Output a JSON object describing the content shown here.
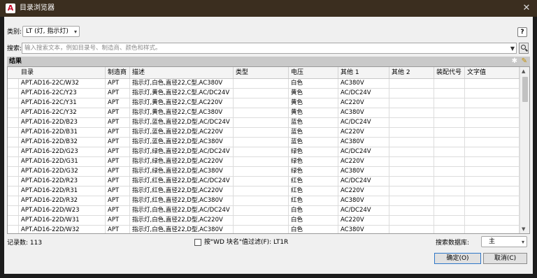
{
  "window": {
    "title": "目录浏览器",
    "app_icon": "A"
  },
  "category": {
    "label": "类别:",
    "value": "LT (灯, 指示灯)"
  },
  "search": {
    "label": "搜索:",
    "placeholder": "输入搜索文本，例如目录号、制造商、颜色和样式。"
  },
  "results": {
    "label": "结果"
  },
  "table": {
    "columns": [
      "目录",
      "制造商",
      "描述",
      "类型",
      "电压",
      "其他 1",
      "其他 2",
      "装配代号",
      "文字值"
    ],
    "rows": [
      [
        "APT.AD16-22C/W32",
        "APT",
        "指示灯,白色,直径22,C型,AC380V",
        "",
        "白色",
        "AC380V",
        "",
        "",
        ""
      ],
      [
        "APT.AD16-22C/Y23",
        "APT",
        "指示灯,黄色,直径22,C型,AC/DC24V",
        "",
        "黄色",
        "AC/DC24V",
        "",
        "",
        ""
      ],
      [
        "APT.AD16-22C/Y31",
        "APT",
        "指示灯,黄色,直径22,C型,AC220V",
        "",
        "黄色",
        "AC220V",
        "",
        "",
        ""
      ],
      [
        "APT.AD16-22C/Y32",
        "APT",
        "指示灯,黄色,直径22,C型,AC380V",
        "",
        "黄色",
        "AC380V",
        "",
        "",
        ""
      ],
      [
        "APT.AD16-22D/B23",
        "APT",
        "指示灯,蓝色,直径22,D型,AC/DC24V",
        "",
        "蓝色",
        "AC/DC24V",
        "",
        "",
        ""
      ],
      [
        "APT.AD16-22D/B31",
        "APT",
        "指示灯,蓝色,直径22,D型,AC220V",
        "",
        "蓝色",
        "AC220V",
        "",
        "",
        ""
      ],
      [
        "APT.AD16-22D/B32",
        "APT",
        "指示灯,蓝色,直径22,D型,AC380V",
        "",
        "蓝色",
        "AC380V",
        "",
        "",
        ""
      ],
      [
        "APT.AD16-22D/G23",
        "APT",
        "指示灯,绿色,直径22,D型,AC/DC24V",
        "",
        "绿色",
        "AC/DC24V",
        "",
        "",
        ""
      ],
      [
        "APT.AD16-22D/G31",
        "APT",
        "指示灯,绿色,直径22,D型,AC220V",
        "",
        "绿色",
        "AC220V",
        "",
        "",
        ""
      ],
      [
        "APT.AD16-22D/G32",
        "APT",
        "指示灯,绿色,直径22,D型,AC380V",
        "",
        "绿色",
        "AC380V",
        "",
        "",
        ""
      ],
      [
        "APT.AD16-22D/R23",
        "APT",
        "指示灯,红色,直径22,D型,AC/DC24V",
        "",
        "红色",
        "AC/DC24V",
        "",
        "",
        ""
      ],
      [
        "APT.AD16-22D/R31",
        "APT",
        "指示灯,红色,直径22,D型,AC220V",
        "",
        "红色",
        "AC220V",
        "",
        "",
        ""
      ],
      [
        "APT.AD16-22D/R32",
        "APT",
        "指示灯,红色,直径22,D型,AC380V",
        "",
        "红色",
        "AC380V",
        "",
        "",
        ""
      ],
      [
        "APT.AD16-22D/W23",
        "APT",
        "指示灯,白色,直径22,D型,AC/DC24V",
        "",
        "白色",
        "AC/DC24V",
        "",
        "",
        ""
      ],
      [
        "APT.AD16-22D/W31",
        "APT",
        "指示灯,白色,直径22,D型,AC220V",
        "",
        "白色",
        "AC220V",
        "",
        "",
        ""
      ],
      [
        "APT.AD16-22D/W32",
        "APT",
        "指示灯,白色,直径22,D型,AC380V",
        "",
        "白色",
        "AC380V",
        "",
        "",
        ""
      ]
    ]
  },
  "footer": {
    "record_count": "记录数: 113",
    "filter_label": "按\"WD 块名\"值过滤(F): LT1R",
    "db_label": "搜索数据库:",
    "db_value": "主",
    "ok_label": "确定(O)",
    "cancel_label": "取消(C)"
  },
  "icons": [
    "close-icon",
    "help-icon",
    "search-icon",
    "star-icon",
    "pencil-icon",
    "chevron-down-icon"
  ]
}
